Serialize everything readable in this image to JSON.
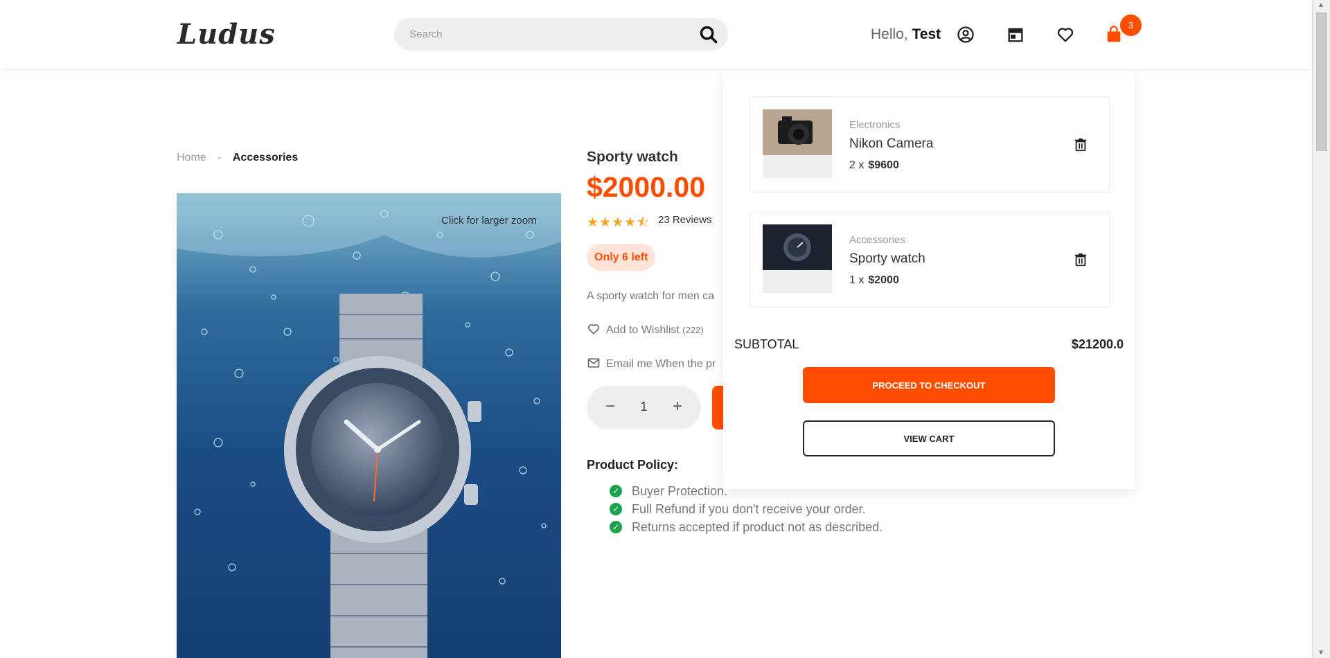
{
  "header": {
    "logo": "Ludus",
    "search_placeholder": "Search",
    "greeting": "Hello,",
    "username": "Test",
    "cart_count": "3",
    "icons": [
      "user-icon",
      "store-icon",
      "heart-icon",
      "shopping-bag-icon"
    ]
  },
  "breadcrumb": {
    "home": "Home",
    "separator": "-",
    "current": "Accessories"
  },
  "product": {
    "zoom_hint": "Click for larger zoom",
    "title": "Sporty watch",
    "price": "$2000.00",
    "rating": 4.5,
    "stars": "★★★★⯪",
    "reviews": "23 Reviews",
    "stock": "Only 6 left",
    "description": "A sporty watch for men ca",
    "wishlist_label": "Add to Wishlist",
    "wishlist_count": "(222)",
    "email_label": "Email me When the pr",
    "quantity": "1",
    "qty_minus": "−",
    "qty_plus": "+",
    "policy_title": "Product Policy:",
    "policies": [
      "Buyer Protection.",
      "Full Refund if you don't receive your order.",
      "Returns accepted if product not as described."
    ]
  },
  "cart": {
    "items": [
      {
        "category": "Electronics",
        "name": "Nikon Camera",
        "qty": "2 x",
        "price": "$9600"
      },
      {
        "category": "Accessories",
        "name": "Sporty watch",
        "qty": "1 x",
        "price": "$2000"
      }
    ],
    "subtotal_label": "SUBTOTAL",
    "subtotal_value": "$21200.0",
    "checkout_label": "PROCEED TO CHECKOUT",
    "view_cart_label": "VIEW CART"
  },
  "colors": {
    "accent": "#ff4d00",
    "check": "#1aa34a",
    "star": "#f5a623"
  }
}
